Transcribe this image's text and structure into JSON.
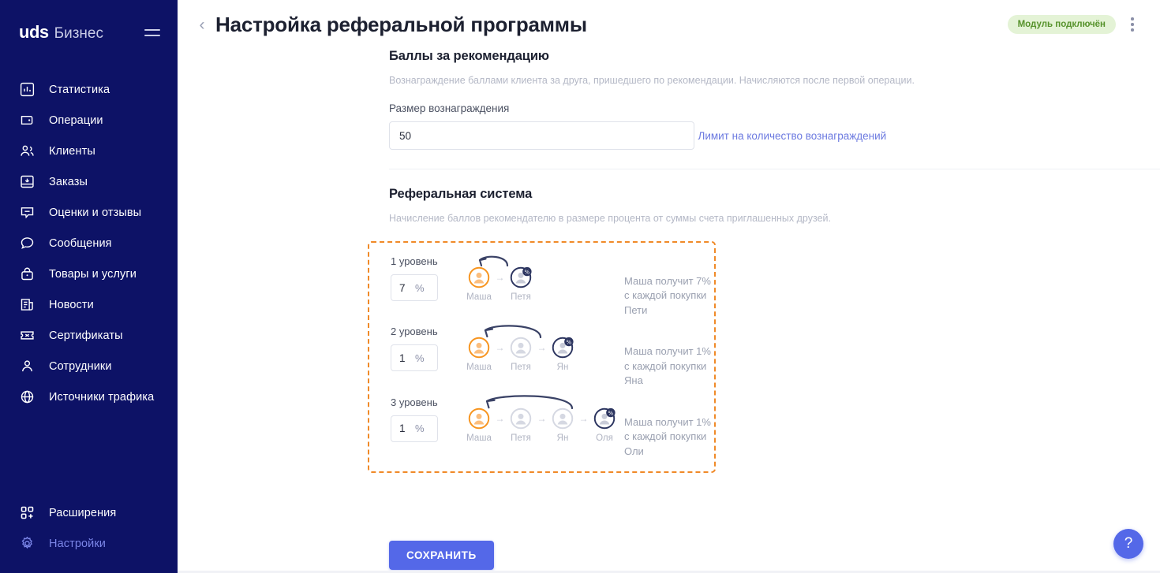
{
  "sidebar": {
    "brand_main": "uds",
    "brand_sub": "Бизнес",
    "menu_icon": "hamburger-icon",
    "items": [
      {
        "label": "Статистика",
        "icon": "chart-bar-icon",
        "active": false
      },
      {
        "label": "Операции",
        "icon": "wallet-icon",
        "active": false
      },
      {
        "label": "Клиенты",
        "icon": "users-icon",
        "active": false
      },
      {
        "label": "Заказы",
        "icon": "inbox-down-icon",
        "active": false
      },
      {
        "label": "Оценки и отзывы",
        "icon": "comment-icon",
        "active": false
      },
      {
        "label": "Сообщения",
        "icon": "chat-bubble-icon",
        "active": false
      },
      {
        "label": "Товары и услуги",
        "icon": "bag-icon",
        "active": false
      },
      {
        "label": "Новости",
        "icon": "news-icon",
        "active": false
      },
      {
        "label": "Сертификаты",
        "icon": "ticket-icon",
        "active": false
      },
      {
        "label": "Сотрудники",
        "icon": "person-icon",
        "active": false
      },
      {
        "label": "Источники трафика",
        "icon": "globe-icon",
        "active": false
      }
    ],
    "bottom_items": [
      {
        "label": "Расширения",
        "icon": "grid-plus-icon",
        "active": false
      },
      {
        "label": "Настройки",
        "icon": "gear-icon",
        "active": true
      }
    ],
    "colors": {
      "background": "#0d1266",
      "active_text": "#7b86e8",
      "text": "#ffffff"
    }
  },
  "header": {
    "back_icon": "chevron-left-icon",
    "title": "Настройка реферальной программы",
    "badge_label": "Модуль подключён",
    "badge_bg": "#e4f3d6",
    "badge_color": "#56922b",
    "kebab_icon": "more-vertical-icon"
  },
  "reward_section": {
    "title": "Баллы за рекомендацию",
    "description": "Вознаграждение баллами клиента за друга, пришедшего по рекомендации. Начисляются после первой операции.",
    "field_label": "Размер вознаграждения",
    "field_value": "50",
    "field_placeholder": "",
    "limit_link": "Лимит на количество вознаграждений",
    "link_color": "#6c7ae0"
  },
  "referral_section": {
    "title": "Реферальная система",
    "description": "Начисление баллов рекомендателю в размере процента от суммы счета приглашенных друзей.",
    "box_border_color": "#f08a28",
    "percent_sign": "%",
    "levels": [
      {
        "name": "1 уровень",
        "value": "7",
        "people": [
          "Маша",
          "Петя"
        ],
        "note": "Маша получит 7% с каждой покупки Пети"
      },
      {
        "name": "2 уровень",
        "value": "1",
        "people": [
          "Маша",
          "Петя",
          "Ян"
        ],
        "note": "Маша получит 1% с каждой покупки Яна"
      },
      {
        "name": "3 уровень",
        "value": "1",
        "people": [
          "Маша",
          "Петя",
          "Ян",
          "Оля"
        ],
        "note": "Маша получит 1% с каждой покупки Оли"
      }
    ]
  },
  "footer": {
    "save_label": "СОХРАНИТЬ",
    "save_color": "#5468e8",
    "help_label": "?",
    "help_icon": "question-mark-icon"
  }
}
